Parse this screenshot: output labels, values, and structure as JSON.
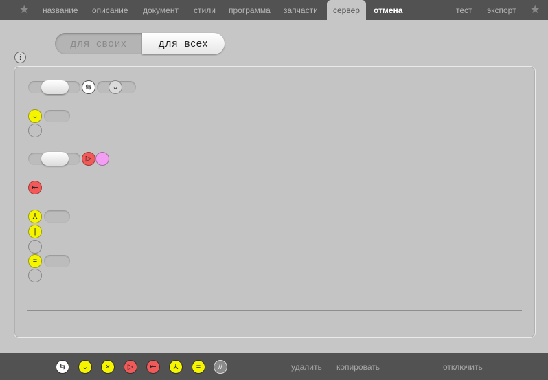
{
  "top_tabs": {
    "name": "название",
    "description": "описание",
    "document": "документ",
    "styles": "стили",
    "program": "программа",
    "parts": "запчасти",
    "server": "сервер",
    "cancel": "отмена",
    "test": "тест",
    "export": "экспорт"
  },
  "segment": {
    "left_label": "для своих",
    "right_label": "для всех"
  },
  "icons": {
    "star": "star-icon",
    "chain": "chain-icon",
    "swap": "swap-arrows-icon",
    "chevron": "chevron-down-icon",
    "play": "play-icon",
    "exit": "exit-arrow-icon",
    "fork": "fork-icon",
    "line": "vertical-line-icon",
    "equals": "equals-icon",
    "cross": "cross-icon",
    "slash": "double-slash-icon"
  },
  "colors": {
    "yellow": "#f5f500",
    "red": "#f25a5a",
    "pink": "#f39ef3",
    "bar": "#525252"
  },
  "bottom_actions": {
    "delete": "удалить",
    "copy": "копировать",
    "disable": "отключить"
  }
}
